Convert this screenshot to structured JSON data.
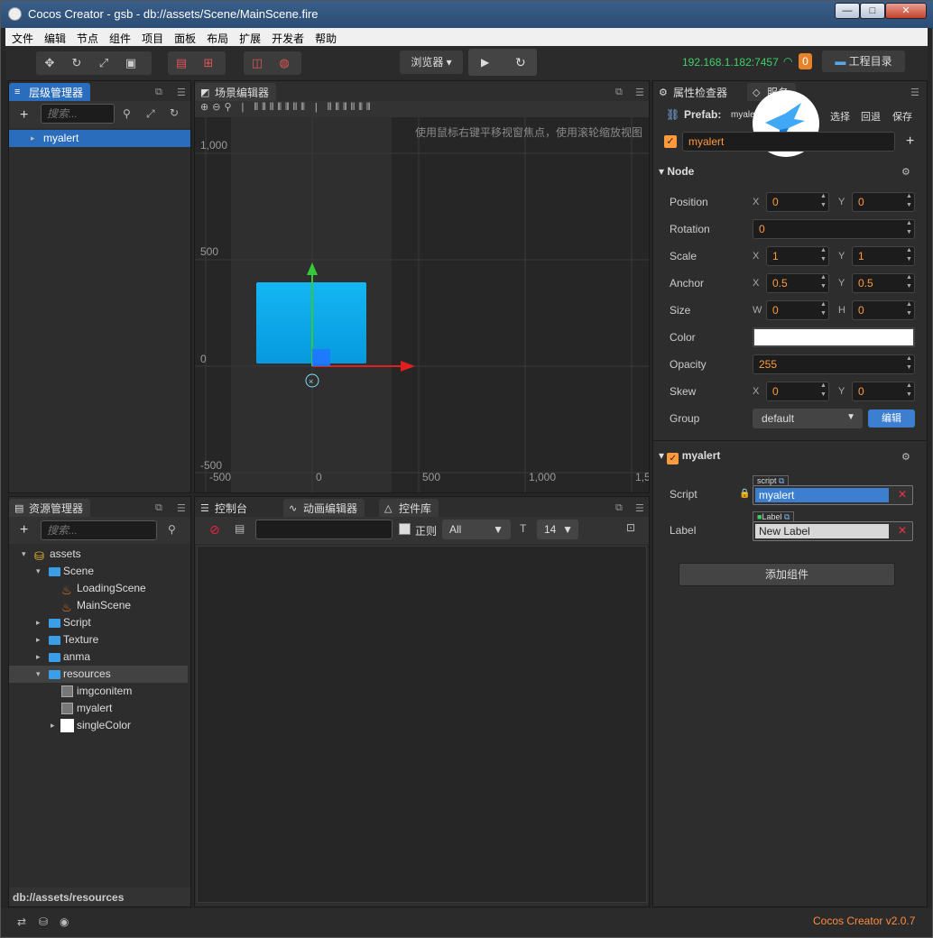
{
  "window": {
    "title": "Cocos Creator - gsb - db://assets/Scene/MainScene.fire",
    "min": "—",
    "max": "□",
    "close": "✕"
  },
  "menu": [
    "文件",
    "编辑",
    "节点",
    "组件",
    "项目",
    "面板",
    "布局",
    "扩展",
    "开发者",
    "帮助"
  ],
  "toolbar": {
    "preview_select": "浏览器",
    "ip": "192.168.1.182:7457",
    "wifi_count": "0",
    "project_dir": "工程目录"
  },
  "hierarchy": {
    "tab": "层级管理器",
    "search_placeholder": "搜索...",
    "items": [
      "myalert"
    ]
  },
  "scene": {
    "tab": "场景编辑器",
    "hint": "使用鼠标右键平移视窗焦点，使用滚轮缩放视图",
    "y_labels": [
      "1,000",
      "500",
      "0",
      "-500"
    ],
    "x_labels": [
      "-500",
      "0",
      "500",
      "1,000",
      "1,5"
    ]
  },
  "assets": {
    "tab": "资源管理器",
    "search_placeholder": "搜索...",
    "tree": [
      "assets",
      "Scene",
      "LoadingScene",
      "MainScene",
      "Script",
      "Texture",
      "anma",
      "resources",
      "imgconitem",
      "myalert",
      "singleColor"
    ],
    "footer": "db://assets/resources"
  },
  "console": {
    "tabs": [
      "控制台",
      "动画编辑器",
      "控件库"
    ],
    "regex_label": "正则",
    "level": "All",
    "font_size": "14"
  },
  "inspector": {
    "tabs": [
      "属性检查器",
      "服务"
    ],
    "prefab_label": "Prefab:",
    "prefab_name": "myalert",
    "prefab_actions": [
      "选择",
      "回退",
      "保存"
    ],
    "node_name": "myalert",
    "node_section": "Node",
    "props": {
      "position": {
        "label": "Position",
        "x": "0",
        "y": "0"
      },
      "rotation": {
        "label": "Rotation",
        "v": "0"
      },
      "scale": {
        "label": "Scale",
        "x": "1",
        "y": "1"
      },
      "anchor": {
        "label": "Anchor",
        "x": "0.5",
        "y": "0.5"
      },
      "size": {
        "label": "Size",
        "w": "0",
        "h": "0"
      },
      "color": {
        "label": "Color",
        "value": "#ffffff"
      },
      "opacity": {
        "label": "Opacity",
        "v": "255"
      },
      "skew": {
        "label": "Skew",
        "x": "0",
        "y": "0"
      },
      "group": {
        "label": "Group",
        "v": "default",
        "edit": "编辑"
      }
    },
    "axis": {
      "x": "X",
      "y": "Y",
      "w": "W",
      "h": "H"
    },
    "component": {
      "name": "myalert",
      "script_label": "Script",
      "script_tag": "script",
      "script_value": "myalert",
      "label_label": "Label",
      "label_tag": "Label",
      "label_value": "New Label"
    },
    "add_component": "添加组件"
  },
  "status": {
    "version": "Cocos Creator v2.0.7"
  }
}
